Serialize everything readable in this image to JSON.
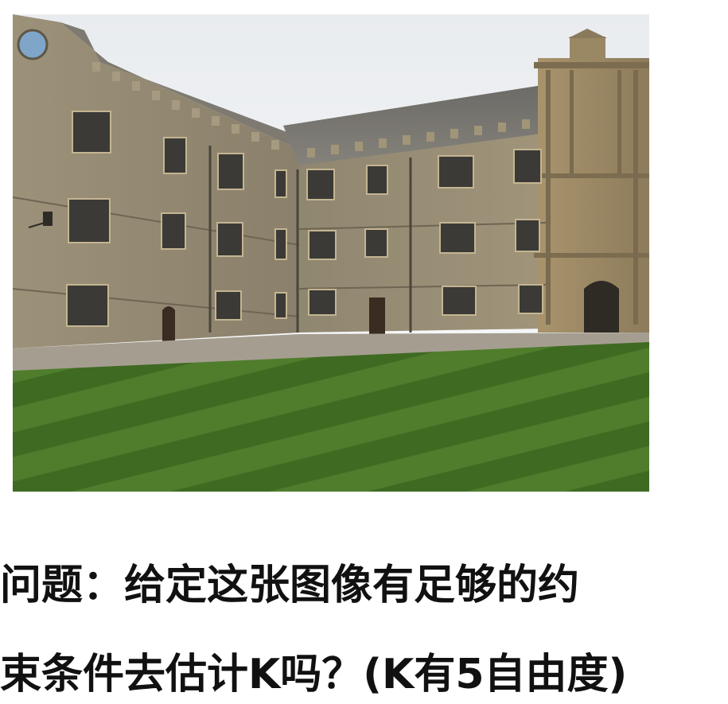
{
  "slide": {
    "photo": {
      "subject": "stone-college-quadrangle-with-striped-lawn"
    },
    "question": {
      "line1": "问题：给定这张图像有足够的约",
      "line2": "束条件去估计K吗？(K有5自由度)"
    }
  }
}
